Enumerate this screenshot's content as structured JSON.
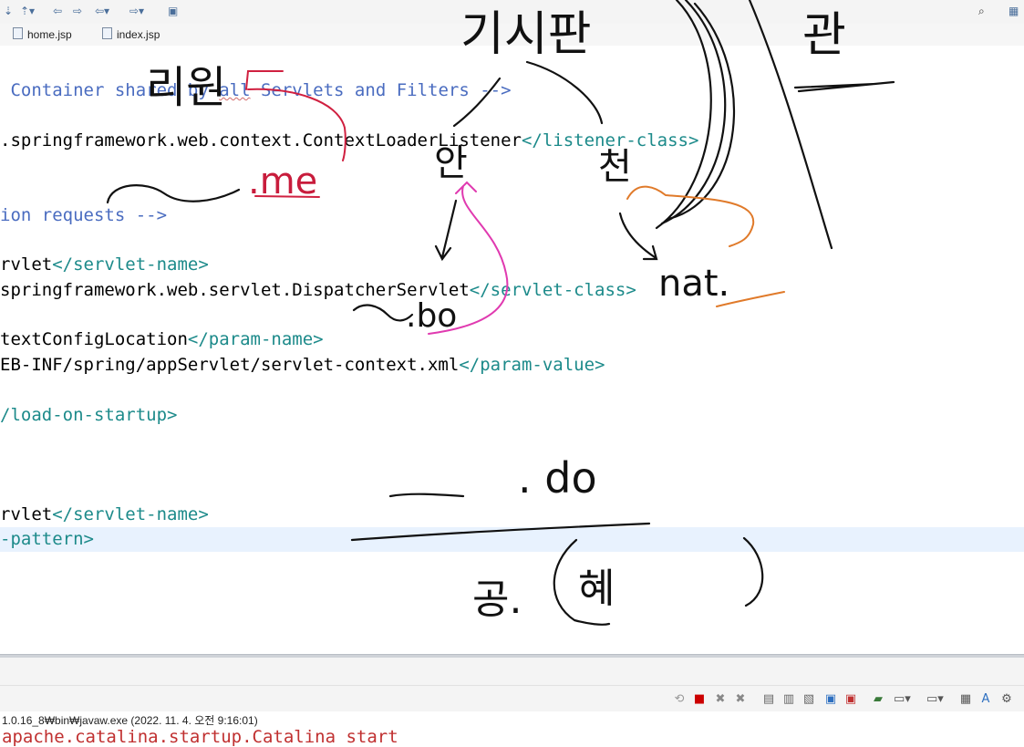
{
  "tabs": [
    {
      "label": "home.jsp"
    },
    {
      "label": "index.jsp"
    }
  ],
  "editor_lines": [
    {
      "parts": [
        {
          "t": " Container shared by ",
          "cls": "c"
        },
        {
          "t": "all",
          "cls": "c sq"
        },
        {
          "t": " Servlets and Filters -->",
          "cls": "c"
        }
      ]
    },
    {
      "parts": [
        {
          "t": ".springframework.web.context.ContextLoaderListener",
          "cls": "k"
        },
        {
          "t": "</listener-class>",
          "cls": "t"
        }
      ]
    },
    {
      "parts": [
        {
          "t": "ion requests -->",
          "cls": "c"
        }
      ]
    },
    {
      "parts": [
        {
          "t": "rvlet",
          "cls": "k"
        },
        {
          "t": "</servlet-name>",
          "cls": "t"
        }
      ]
    },
    {
      "parts": [
        {
          "t": "springframework.web.servlet.DispatcherServlet",
          "cls": "k"
        },
        {
          "t": "</servlet-class>",
          "cls": "t"
        }
      ]
    },
    {
      "parts": [
        {
          "t": "textConfigLocation",
          "cls": "k"
        },
        {
          "t": "</param-name>",
          "cls": "t"
        }
      ]
    },
    {
      "parts": [
        {
          "t": "EB-INF/spring/appServlet/servlet-context.xml",
          "cls": "k"
        },
        {
          "t": "</param-value>",
          "cls": "t"
        }
      ]
    },
    {
      "parts": [
        {
          "t": "/load-on-startup>",
          "cls": "t"
        }
      ]
    },
    {
      "parts": [
        {
          "t": "rvlet",
          "cls": "k"
        },
        {
          "t": "</servlet-name>",
          "cls": "t"
        }
      ]
    },
    {
      "parts": [
        {
          "t": "-pattern>",
          "cls": "t"
        }
      ]
    }
  ],
  "console": {
    "description": "1.0.16_8₩bin₩javaw.exe  (2022. 11. 4. 오전 9:16:01)",
    "output": "apache.catalina.startup.Catalina start"
  },
  "handwriting": {
    "top_left": "리원",
    "top_center": "기시판",
    "top_right": "관",
    "me": ".me",
    "an": "안",
    "bo": ".bo",
    "cheom": "천",
    "nat": "nat.",
    "do": ". do",
    "gong": "공.",
    "hyeo": "혜"
  }
}
